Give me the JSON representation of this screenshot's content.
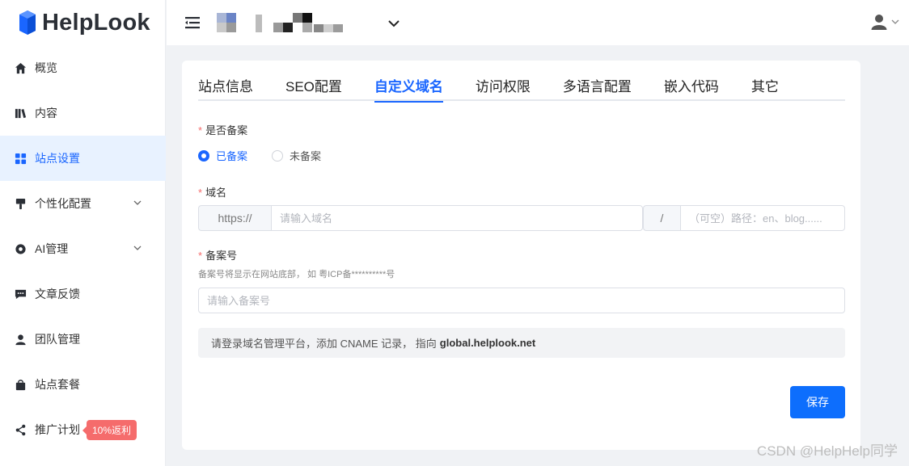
{
  "brand": {
    "name": "HelpLook"
  },
  "sidebar": {
    "items": [
      {
        "label": "概览",
        "icon": "home-icon"
      },
      {
        "label": "内容",
        "icon": "book-icon"
      },
      {
        "label": "站点设置",
        "icon": "grid-icon",
        "active": true
      },
      {
        "label": "个性化配置",
        "icon": "brush-icon",
        "expandable": true
      },
      {
        "label": "AI管理",
        "icon": "ai-icon",
        "expandable": true
      },
      {
        "label": "文章反馈",
        "icon": "comment-icon"
      },
      {
        "label": "团队管理",
        "icon": "user-icon"
      },
      {
        "label": "站点套餐",
        "icon": "bag-icon"
      },
      {
        "label": "推广计划",
        "icon": "share-icon",
        "badge": "10%返利"
      }
    ]
  },
  "header": {
    "site_selector": "blurred",
    "user": "user-avatar-icon"
  },
  "tabs": [
    {
      "label": "站点信息"
    },
    {
      "label": "SEO配置"
    },
    {
      "label": "自定义域名",
      "active": true
    },
    {
      "label": "访问权限"
    },
    {
      "label": "多语言配置"
    },
    {
      "label": "嵌入代码"
    },
    {
      "label": "其它"
    }
  ],
  "form": {
    "filing_label": "是否备案",
    "radio_filed": "已备案",
    "radio_unfiled": "未备案",
    "domain_label": "域名",
    "protocol_prefix": "https://",
    "domain_placeholder": "请输入域名",
    "path_separator": "/",
    "path_placeholder": "（可空）路径：en、blog......",
    "icp_label": "备案号",
    "icp_hint": "备案号将显示在网站底部， 如 粤ICP备**********号",
    "icp_placeholder": "请输入备案号",
    "notice_text": "请登录域名管理平台，添加 CNAME 记录， 指向",
    "notice_target": "global.helplook.net",
    "save_label": "保存"
  },
  "colors": {
    "accent": "#1a66ff",
    "required": "#f56c6c",
    "badge": "#f56c6c"
  },
  "watermark": "CSDN @HelpHelp同学"
}
